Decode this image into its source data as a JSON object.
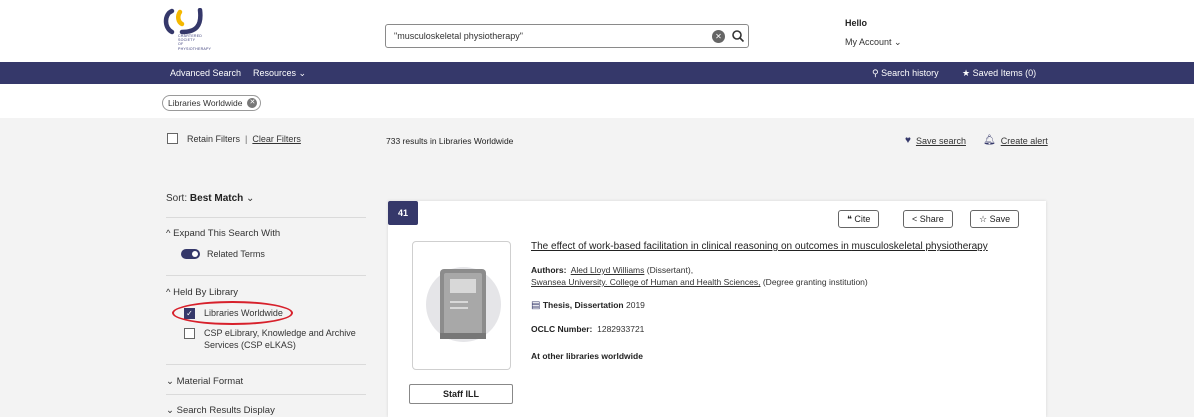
{
  "header": {
    "logo_text": [
      "CHARTERED",
      "SOCIETY",
      "OF",
      "PHYSIOTHERAPY"
    ],
    "search_value": "\"musculoskeletal physiotherapy\"",
    "hello": "Hello",
    "account": "My Account"
  },
  "nav": {
    "advanced_search": "Advanced Search",
    "resources": "Resources",
    "search_history": "Search history",
    "saved_items": "Saved Items (0)"
  },
  "chip": {
    "label": "Libraries Worldwide"
  },
  "filters": {
    "retain": "Retain Filters",
    "clear": "Clear Filters",
    "results": "733 results in Libraries Worldwide",
    "save_search": "Save search",
    "create_alert": "Create alert"
  },
  "facets": {
    "sort_label": "Sort:",
    "sort_value": "Best Match",
    "expand": "Expand This Search With",
    "related_terms": "Related Terms",
    "held_by": "Held By Library",
    "lib_worldwide": "Libraries Worldwide",
    "lib_csp": "CSP eLibrary, Knowledge and Archive Services (CSP eLKAS)",
    "material_format": "Material Format",
    "results_display": "Search Results Display"
  },
  "result": {
    "rank": "41",
    "cite": "Cite",
    "share": "Share",
    "save": "Save",
    "title_a": "The effect of work-based facilitation in clinical reasoning on outcomes in ",
    "title_b": "musculoskeletal physiotherapy",
    "authors_label": "Authors:",
    "author1": "Aled Lloyd Williams",
    "author1_role": "(Dissertant),",
    "author2": "Swansea University. College of Human and Health Sciences,",
    "author2_role": "(Degree granting institution)",
    "type": "Thesis, Dissertation",
    "year": "2019",
    "oclc_label": "OCLC Number:",
    "oclc": "1282933721",
    "availability": "At other libraries worldwide",
    "staff_ill": "Staff ILL"
  },
  "colors": {
    "brand_navy": "#35386a",
    "annotation_red": "#d7202b",
    "highlight_yellow": "#e8b400"
  }
}
